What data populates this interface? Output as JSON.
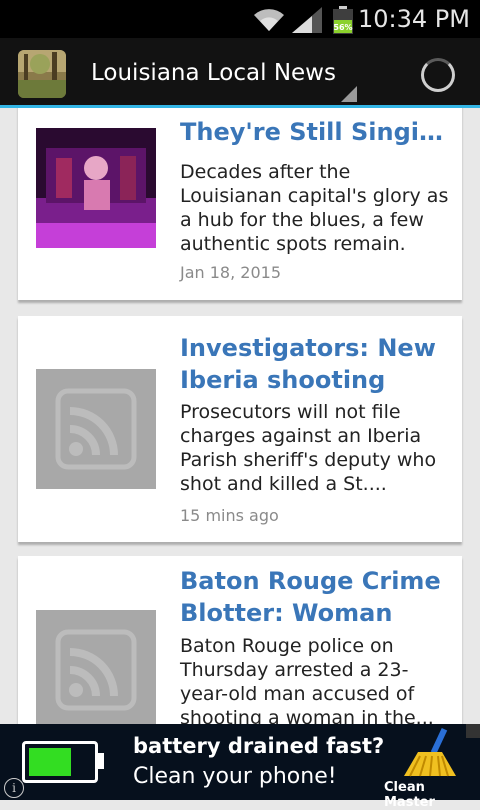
{
  "status_bar": {
    "time": "10:34 PM",
    "battery_percent": "56%"
  },
  "action_bar": {
    "title": "Louisiana Local News",
    "app_icon": "forest-thumbnail",
    "refresh_icon": "loading-spinner-icon"
  },
  "articles": [
    {
      "title": "They're Still Singing...",
      "description": "Decades after the Louisianan capital's glory as a hub for the blues, a few authentic spots remain.",
      "time": "Jan 18, 2015",
      "thumbnail": "concert-photo"
    },
    {
      "title": "Investigators: New Iberia shooting deat...",
      "description": "Prosecutors will not file charges against an Iberia Parish sheriff's deputy who shot and killed a St....",
      "time": "15 mins ago",
      "thumbnail": "rss-icon"
    },
    {
      "title": "Baton Rouge Crime Blotter: Woman sho...",
      "description": "Baton Rouge police on Thursday arrested a 23-year-old man accused of shooting a woman in the...",
      "time": "",
      "thumbnail": "rss-icon"
    }
  ],
  "ad": {
    "line1": "battery drained fast?",
    "line2": "Clean your phone!",
    "brand": "Clean Master",
    "colors": {
      "background": "#06101d",
      "battery_fill": "#33dd22"
    }
  },
  "colors": {
    "title": "#3a76b8",
    "accent": "#33b5e5"
  }
}
